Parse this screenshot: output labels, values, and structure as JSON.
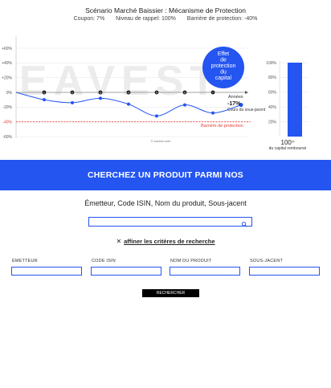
{
  "chart": {
    "title": "Scénario Marché Baissier : Mécanisme de Protection",
    "coupon": "Coupon: 7%",
    "rappel": "Niveau de rappel: 100%",
    "barriere": "Barrière de protection: -40%",
    "watermark": "EAVEST",
    "credit": "© eavest.com",
    "y_ticks": [
      "+60%",
      "+40%",
      "+20%",
      "0%",
      "-20%",
      "-40%",
      "-60%"
    ],
    "x_axis_label": "Années",
    "observation_marks": [
      "1",
      "2",
      "3",
      "4",
      "5",
      "6",
      "7",
      "8"
    ],
    "final_value_label": "-17%",
    "final_value_caption": "Cours du sous-jacent",
    "barrier_label": "Barrière de protection",
    "bubble_lines": [
      "Effet",
      "de",
      "protection",
      "du",
      "capital"
    ],
    "right_ticks": [
      "100%",
      "80%",
      "60%",
      "40%",
      "20%"
    ],
    "right_value": "100",
    "right_unit": "%",
    "right_caption": "du capital remboursé",
    "colors": {
      "accent": "#2455f0",
      "barrier": "#e5403a"
    }
  },
  "chart_data": {
    "type": "line",
    "title": "Scénario Marché Baissier : Mécanisme de Protection",
    "xlabel": "Années",
    "ylabel": "",
    "ylim": [
      -70,
      70
    ],
    "x": [
      0,
      1,
      2,
      3,
      4,
      5,
      6,
      7,
      8
    ],
    "series": [
      {
        "name": "Cours du sous-jacent",
        "values": [
          0,
          -10,
          -14,
          -8,
          -16,
          -32,
          -17,
          -28,
          -17
        ]
      }
    ],
    "barrier": -40,
    "observation_values": [
      -10,
      -14,
      -8,
      -32,
      -17,
      -28,
      -17
    ],
    "final_value": -17,
    "capital_reimbursed": 100
  },
  "band": {
    "title": "CHERCHEZ UN PRODUIT PARMI NOS"
  },
  "search": {
    "hint": "Émetteur, Code ISIN, Nom du produit, Sous-jacent",
    "value": "",
    "icon": "search-icon"
  },
  "refine": {
    "x": "✕",
    "label": "affiner les critères de recherche"
  },
  "filters": [
    {
      "label": "ÉMETTEUR",
      "value": ""
    },
    {
      "label": "CODE ISIN",
      "value": ""
    },
    {
      "label": "NOM DU PRODUIT",
      "value": ""
    },
    {
      "label": "SOUS-JACENT",
      "value": ""
    }
  ],
  "submit": {
    "label": "RECHERCHER"
  }
}
